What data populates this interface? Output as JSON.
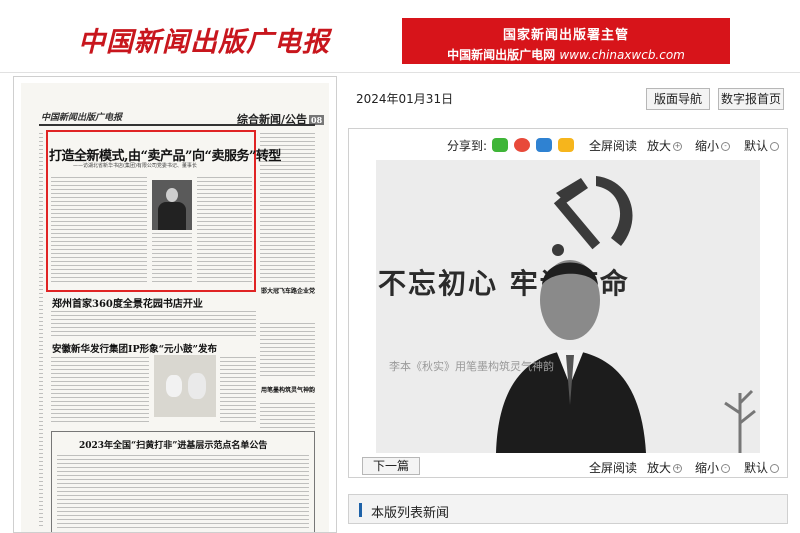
{
  "header": {
    "logo_text": "中国新闻出版广电报",
    "banner_line1": "国家新闻出版署主管",
    "banner_line2_prefix": "中国新闻出版广电网 ",
    "banner_url": "www.chinaxwcb.com"
  },
  "paper": {
    "masthead": "中国新闻出版广电报",
    "section_title": "综合新闻/公告",
    "section_num": "08",
    "headline": "打造全新模式,由“卖产品”向“卖服务”转型",
    "subheadline": "——访湖北省新华书店(集团)有限公司党委书记、董事长",
    "headline2": "郑州首家360度全景花园书店开业",
    "headline3": "安徽新华发行集团IP形象“元小鼓”发布",
    "headline4": "2023年全国“扫黄打非”进基层示范点名单公告"
  },
  "viewer": {
    "date": "2024年01月31日",
    "nav_button": "版面导航",
    "home_button": "数字报首页",
    "share_label": "分享到:",
    "share_icons": [
      "wechat-icon",
      "weibo-icon",
      "qq-icon",
      "qzone-icon"
    ],
    "fullscreen": "全屏阅读",
    "zoom_in": "放大",
    "zoom_out": "缩小",
    "default": "默认",
    "photo_slogan": "不忘初心  牢记使命",
    "watermark": "李本《秋实》用笔墨构筑灵气神韵",
    "prev_button": "下一篇",
    "list_title": "本版列表新闻"
  },
  "colors": {
    "brand_red": "#d7141a",
    "highlight_red": "#e02424",
    "list_accent": "#1e62a8"
  }
}
